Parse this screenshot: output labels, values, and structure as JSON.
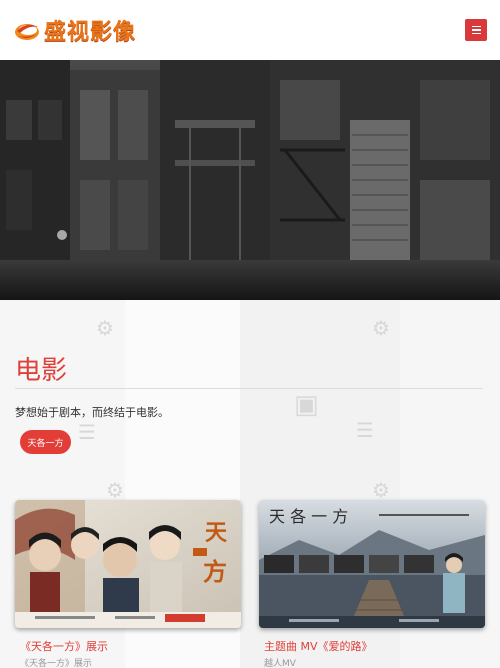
{
  "header": {
    "brand": "盛视影像",
    "menu_icon": "hamburger-menu-icon",
    "accent_color": "#d9393b"
  },
  "section": {
    "title": "电影",
    "description": "梦想始于剧本，而终结于电影。",
    "filter_tag": "天各一方"
  },
  "cards": [
    {
      "title": "《天各一方》展示",
      "subtitle": "《天各一方》展示",
      "poster_text": "天各一方"
    },
    {
      "title": "主题曲 MV《爱的路》",
      "subtitle": "越人MV",
      "poster_text": "天各一方"
    }
  ]
}
